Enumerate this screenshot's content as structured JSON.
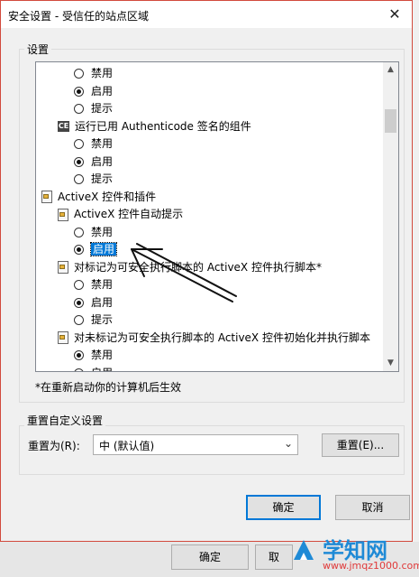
{
  "dialog": {
    "title": "安全设置 - 受信任的站点区域",
    "close_glyph": "✕"
  },
  "settings": {
    "group_label": "设置",
    "tree": [
      {
        "type": "radio",
        "label": "禁用",
        "checked": false,
        "level": 2
      },
      {
        "type": "radio",
        "label": "启用",
        "checked": true,
        "level": 2
      },
      {
        "type": "radio",
        "label": "提示",
        "checked": false,
        "level": 2
      },
      {
        "type": "item",
        "icon": "certificate-icon",
        "label": "运行已用 Authenticode 签名的组件",
        "level": 1
      },
      {
        "type": "radio",
        "label": "禁用",
        "checked": false,
        "level": 2
      },
      {
        "type": "radio",
        "label": "启用",
        "checked": true,
        "level": 2
      },
      {
        "type": "radio",
        "label": "提示",
        "checked": false,
        "level": 2
      },
      {
        "type": "item",
        "icon": "settings-page-icon",
        "label": "ActiveX 控件和插件",
        "level": 0
      },
      {
        "type": "item",
        "icon": "settings-page-icon",
        "label": "ActiveX 控件自动提示",
        "level": 1
      },
      {
        "type": "radio",
        "label": "禁用",
        "checked": false,
        "level": 2
      },
      {
        "type": "radio",
        "label": "启用",
        "checked": true,
        "level": 2,
        "selected": true
      },
      {
        "type": "item",
        "icon": "settings-page-icon",
        "label": "对标记为可安全执行脚本的 ActiveX 控件执行脚本*",
        "level": 1
      },
      {
        "type": "radio",
        "label": "禁用",
        "checked": false,
        "level": 2
      },
      {
        "type": "radio",
        "label": "启用",
        "checked": true,
        "level": 2
      },
      {
        "type": "radio",
        "label": "提示",
        "checked": false,
        "level": 2
      },
      {
        "type": "item",
        "icon": "settings-page-icon",
        "label": "对未标记为可安全执行脚本的 ActiveX 控件初始化并执行脚本",
        "level": 1
      },
      {
        "type": "radio",
        "label": "禁用",
        "checked": true,
        "level": 2
      },
      {
        "type": "radio",
        "label": "启用",
        "checked": false,
        "level": 2
      }
    ],
    "note": "*在重新启动你的计算机后生效"
  },
  "reset": {
    "group_label": "重置自定义设置",
    "reset_to_label": "重置为(R):",
    "select_value": "中 (默认值)",
    "reset_button": "重置(E)..."
  },
  "buttons": {
    "ok": "确定",
    "cancel": "取消"
  },
  "parent_window": {
    "ok": "确定",
    "partial": "取"
  },
  "watermark": {
    "brand": "学知网",
    "url": "www.jmqz1000.com"
  },
  "colors": {
    "selection": "#0078d7",
    "dialog_border": "#d24a3d",
    "watermark_blue": "#1f8ad6"
  }
}
